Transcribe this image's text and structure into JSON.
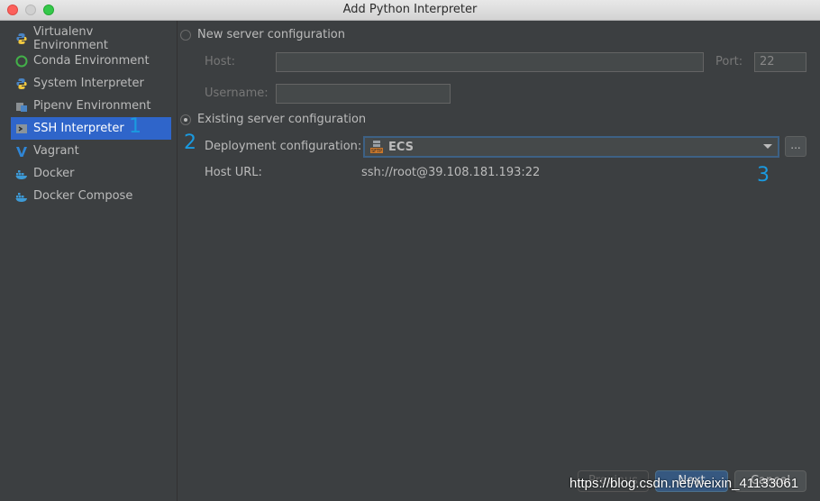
{
  "window": {
    "title": "Add Python Interpreter"
  },
  "sidebar": {
    "items": [
      {
        "label": "Virtualenv Environment",
        "icon": "python-icon",
        "selected": false
      },
      {
        "label": "Conda Environment",
        "icon": "conda-icon",
        "selected": false
      },
      {
        "label": "System Interpreter",
        "icon": "python-icon",
        "selected": false
      },
      {
        "label": "Pipenv Environment",
        "icon": "pipenv-icon",
        "selected": false
      },
      {
        "label": "SSH Interpreter",
        "icon": "ssh-icon",
        "selected": true
      },
      {
        "label": "Vagrant",
        "icon": "vagrant-icon",
        "selected": false
      },
      {
        "label": "Docker",
        "icon": "docker-icon",
        "selected": false
      },
      {
        "label": "Docker Compose",
        "icon": "docker-icon",
        "selected": false
      }
    ]
  },
  "new_server": {
    "radio_label": "New server configuration",
    "checked": false,
    "host_label": "Host:",
    "host_value": "",
    "port_label": "Port:",
    "port_value": "22",
    "username_label": "Username:",
    "username_value": ""
  },
  "existing_server": {
    "radio_label": "Existing server configuration",
    "checked": true,
    "deployment_label": "Deployment configuration:",
    "deployment_value": "ECS",
    "deployment_icon": "sftp-server-icon",
    "browse_label": "...",
    "host_url_label": "Host URL:",
    "host_url_value": "ssh://root@39.108.181.193:22"
  },
  "annotations": {
    "a1": "1",
    "a2": "2",
    "a3": "3"
  },
  "footer": {
    "previous_label": "Previous",
    "next_label": "Next",
    "cancel_label": "Cancel"
  },
  "watermark": "https://blog.csdn.net/weixin_41133061",
  "colors": {
    "selection": "#2f65ca",
    "annotation": "#1a9ae0",
    "background": "#3c3f41"
  }
}
